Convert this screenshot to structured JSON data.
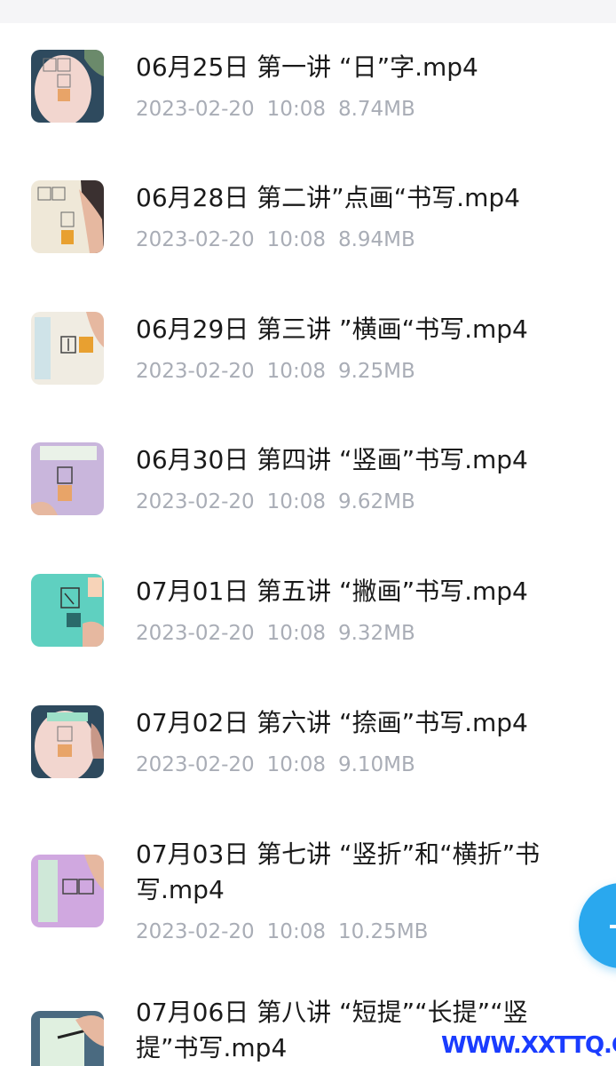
{
  "files": [
    {
      "name": "06月25日 第一讲 “日”字.mp4",
      "date": "2023-02-20",
      "time": "10:08",
      "size": "8.74MB",
      "thumb_icon": "video-thumbnail-icon"
    },
    {
      "name": "06月28日 第二讲”点画“书写.mp4",
      "date": "2023-02-20",
      "time": "10:08",
      "size": "8.94MB",
      "thumb_icon": "video-thumbnail-icon"
    },
    {
      "name": "06月29日 第三讲 ”横画“书写.mp4",
      "date": "2023-02-20",
      "time": "10:08",
      "size": "9.25MB",
      "thumb_icon": "video-thumbnail-icon"
    },
    {
      "name": "06月30日 第四讲 “竖画”书写.mp4",
      "date": "2023-02-20",
      "time": "10:08",
      "size": "9.62MB",
      "thumb_icon": "video-thumbnail-icon"
    },
    {
      "name": "07月01日 第五讲  “撇画”书写.mp4",
      "date": "2023-02-20",
      "time": "10:08",
      "size": "9.32MB",
      "thumb_icon": "video-thumbnail-icon"
    },
    {
      "name": "07月02日 第六讲  “捺画”书写.mp4",
      "date": "2023-02-20",
      "time": "10:08",
      "size": "9.10MB",
      "thumb_icon": "video-thumbnail-icon"
    },
    {
      "name": "07月03日 第七讲 “竖折”和“横折”书写.mp4",
      "date": "2023-02-20",
      "time": "10:08",
      "size": "10.25MB",
      "thumb_icon": "video-thumbnail-icon"
    },
    {
      "name": "07月06日 第八讲 “短提”“长提”“竖提”书写.mp4",
      "date": "",
      "time": "",
      "size": "",
      "thumb_icon": "video-thumbnail-icon"
    }
  ],
  "fab": {
    "icon": "plus-icon",
    "label": "+",
    "color": "#2aa8ee"
  },
  "watermark": "WWW.XXTTQ.COM",
  "colors": {
    "meta_text": "#a9adb6",
    "name_text": "#1a1a1a",
    "watermark": "#1a3cff"
  }
}
